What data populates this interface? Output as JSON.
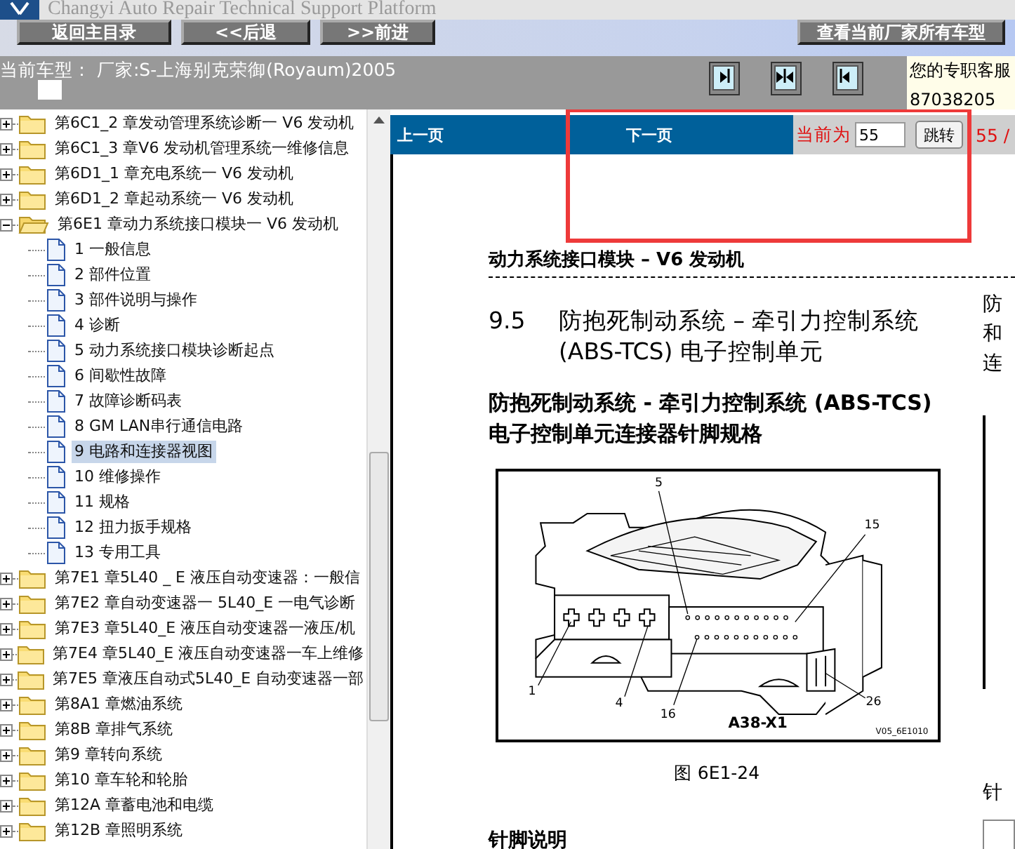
{
  "app_header": {
    "title": "Changyi Auto Repair Technical Support Platform"
  },
  "nav_buttons": [
    "返回主目录",
    "<<后退",
    ">>前进",
    "查看当前厂家所有车型"
  ],
  "vehicle_bar": {
    "label": "当前车型：",
    "value": "厂家:S-上海别克荣御(Royaum)2005"
  },
  "support": {
    "label": "您的专职客服",
    "phone": "87038205"
  },
  "tree": [
    {
      "label": "第6C1_2 章发动管理系统诊断一 V6 发动机",
      "expanded": false
    },
    {
      "label": "第6C1_3 章V6 发动机管理系统一维修信息",
      "expanded": false
    },
    {
      "label": "第6D1_1 章充电系统一 V6 发动机",
      "expanded": false
    },
    {
      "label": "第6D1_2 章起动系统一 V6 发动机",
      "expanded": false
    },
    {
      "label": "第6E1 章动力系统接口模块一 V6 发动机",
      "expanded": true,
      "children": [
        {
          "label": "1 一般信息",
          "selected": false
        },
        {
          "label": "2 部件位置",
          "selected": false
        },
        {
          "label": "3 部件说明与操作",
          "selected": false
        },
        {
          "label": "4 诊断",
          "selected": false
        },
        {
          "label": "5 动力系统接口模块诊断起点",
          "selected": false
        },
        {
          "label": "6 间歇性故障",
          "selected": false
        },
        {
          "label": "7 故障诊断码表",
          "selected": false
        },
        {
          "label": "8 GM LAN串行通信电路",
          "selected": false
        },
        {
          "label": "9 电路和连接器视图",
          "selected": true
        },
        {
          "label": "10 维修操作",
          "selected": false
        },
        {
          "label": "11 规格",
          "selected": false
        },
        {
          "label": "12 扭力扳手规格",
          "selected": false
        },
        {
          "label": "13 专用工具",
          "selected": false
        }
      ]
    },
    {
      "label": "第7E1 章5L40 _ E 液压自动变速器：一般信",
      "expanded": false
    },
    {
      "label": "第7E2 章自动变速器一 5L40_E 一电气诊断",
      "expanded": false
    },
    {
      "label": "第7E3 章5L40_E 液压自动变速器一液压/机",
      "expanded": false
    },
    {
      "label": "第7E4 章5L40_E 液压自动变速器一车上维修",
      "expanded": false
    },
    {
      "label": "第7E5 章液压自动式5L40_E 自动变速器一部",
      "expanded": false
    },
    {
      "label": "第8A1 章燃油系统",
      "expanded": false
    },
    {
      "label": "第8B 章排气系统",
      "expanded": false
    },
    {
      "label": "第9 章转向系统",
      "expanded": false
    },
    {
      "label": "第10 章车轮和轮胎",
      "expanded": false
    },
    {
      "label": "第12A 章蓄电池和电缆",
      "expanded": false
    },
    {
      "label": "第12B 章照明系统",
      "expanded": false
    }
  ],
  "pager": {
    "prev": "上一页",
    "next": "下一页",
    "current_label": "当前为",
    "page": "55",
    "go": "跳转",
    "total": "55 /"
  },
  "document": {
    "section_header": "动力系统接口模块 – V6 发动机",
    "section_number": "9.5",
    "title": "防抱死制动系统 – 牵引力控制系统 (ABS-TCS) 电子控制单元",
    "subtitle": "防抱死制动系统 - 牵引力控制系统 (ABS-TCS) 电子控制单元连接器针脚规格",
    "figure": {
      "callouts": [
        "5",
        "15",
        "1",
        "4",
        "16",
        "26"
      ],
      "connector_label": "A38-X1",
      "image_code": "V05_6E1010"
    },
    "caption": "图 6E1-24",
    "pin_heading": "针脚说明",
    "side_column": {
      "lines": [
        "防",
        "和",
        "连"
      ],
      "heading": "针"
    }
  }
}
